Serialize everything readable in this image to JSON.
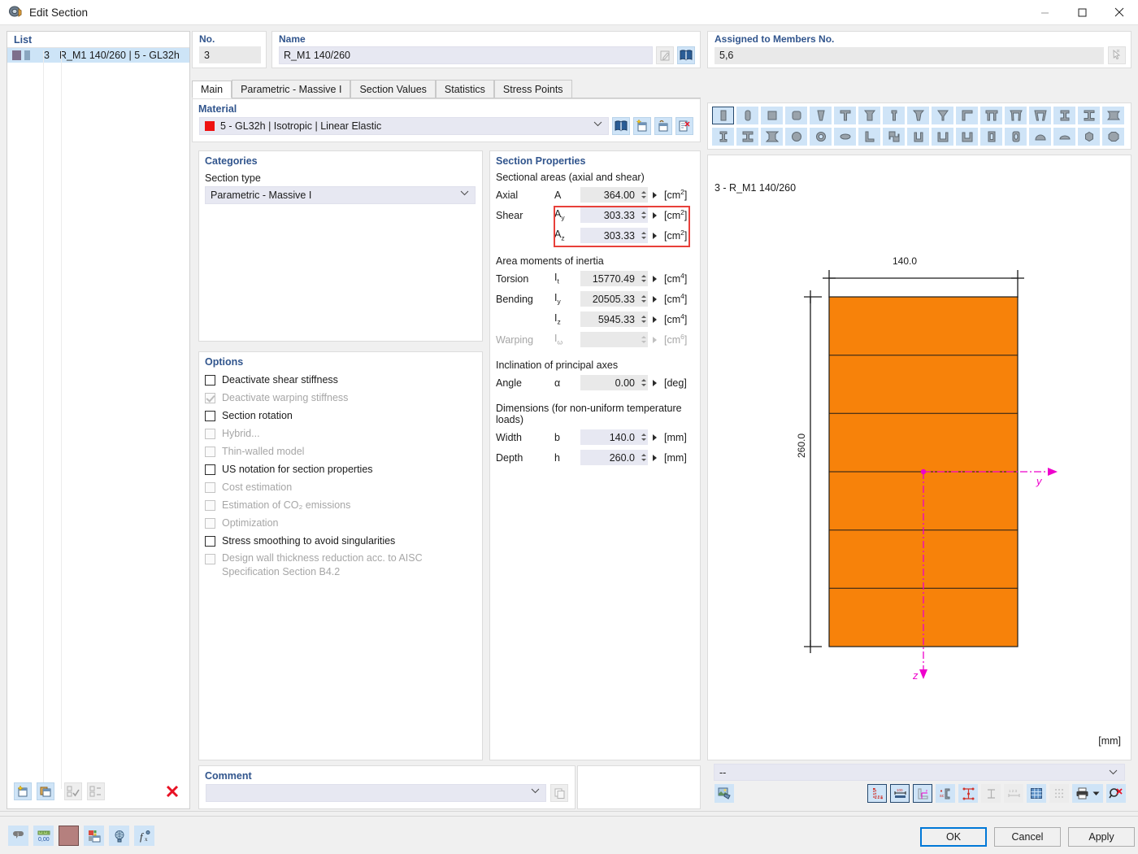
{
  "window": {
    "title": "Edit Section",
    "icon": "section-icon",
    "minimize": "minimize-icon",
    "maximize": "maximize-icon",
    "close": "close-icon"
  },
  "list": {
    "header": "List",
    "rows": [
      {
        "no": "3",
        "name": "R_M1 140/260 | 5 - GL32h"
      }
    ],
    "toolbar": [
      "new-section-icon",
      "copy-section-icon",
      "check-all-icon",
      "renumber-icon",
      "delete-icon"
    ]
  },
  "header": {
    "no_label": "No.",
    "no_value": "3",
    "name_label": "Name",
    "name_value": "R_M1 140/260",
    "name_edit_icon": "edit-icon",
    "name_library_icon": "library-icon",
    "members_label": "Assigned to Members No.",
    "members_value": "5,6",
    "members_pick_icon": "pick-cursor-icon"
  },
  "tabs": [
    {
      "label": "Main",
      "active": true
    },
    {
      "label": "Parametric - Massive I",
      "active": false
    },
    {
      "label": "Section Values",
      "active": false
    },
    {
      "label": "Statistics",
      "active": false
    },
    {
      "label": "Stress Points",
      "active": false
    }
  ],
  "material": {
    "legend": "Material",
    "value": "5 - GL32h | Isotropic | Linear Elastic",
    "swatch_color": "#ee1111",
    "buttons": [
      "material-library-icon",
      "new-material-icon",
      "edit-material-icon",
      "material-info-icon"
    ]
  },
  "categories": {
    "legend": "Categories",
    "section_type_label": "Section type",
    "section_type_value": "Parametric - Massive I"
  },
  "options": {
    "legend": "Options",
    "items": [
      {
        "label": "Deactivate shear stiffness",
        "checked": false,
        "enabled": true
      },
      {
        "label": "Deactivate warping stiffness",
        "checked": true,
        "enabled": false
      },
      {
        "label": "Section rotation",
        "checked": false,
        "enabled": true
      },
      {
        "label": "Hybrid...",
        "checked": false,
        "enabled": false
      },
      {
        "label": "Thin-walled model",
        "checked": false,
        "enabled": false
      },
      {
        "label": "US notation for section properties",
        "checked": false,
        "enabled": true
      },
      {
        "label": "Cost estimation",
        "checked": false,
        "enabled": false
      },
      {
        "label": "Estimation of CO₂ emissions",
        "checked": false,
        "enabled": false
      },
      {
        "label": "Optimization",
        "checked": false,
        "enabled": false
      },
      {
        "label": "Stress smoothing to avoid singularities",
        "checked": false,
        "enabled": true
      },
      {
        "label": "Design wall thickness reduction acc. to AISC Specification Section B4.2",
        "checked": false,
        "enabled": false
      }
    ]
  },
  "section_properties": {
    "legend": "Section Properties",
    "group_areas": "Sectional areas (axial and shear)",
    "group_inertia": "Area moments of inertia",
    "group_axes": "Inclination of principal axes",
    "group_dimensions": "Dimensions (for non-uniform temperature loads)",
    "rows": {
      "axial": {
        "name": "Axial",
        "sym": "A",
        "sub": "",
        "value": "364.00",
        "unit": "cm",
        "exp": "2",
        "enabled": true
      },
      "shear_y": {
        "name": "Shear",
        "sym": "A",
        "sub": "y",
        "value": "303.33",
        "unit": "cm",
        "exp": "2",
        "enabled": true
      },
      "shear_z": {
        "name": "",
        "sym": "A",
        "sub": "z",
        "value": "303.33",
        "unit": "cm",
        "exp": "2",
        "enabled": true
      },
      "torsion": {
        "name": "Torsion",
        "sym": "I",
        "sub": "t",
        "value": "15770.49",
        "unit": "cm",
        "exp": "4",
        "enabled": true
      },
      "bend_y": {
        "name": "Bending",
        "sym": "I",
        "sub": "y",
        "value": "20505.33",
        "unit": "cm",
        "exp": "4",
        "enabled": true
      },
      "bend_z": {
        "name": "",
        "sym": "I",
        "sub": "z",
        "value": "5945.33",
        "unit": "cm",
        "exp": "4",
        "enabled": true
      },
      "warping": {
        "name": "Warping",
        "sym": "I",
        "sub": "ω",
        "value": "",
        "unit": "cm",
        "exp": "6",
        "enabled": false
      },
      "angle": {
        "name": "Angle",
        "sym": "α",
        "sub": "",
        "value": "0.00",
        "unit": "deg",
        "exp": "",
        "enabled": true
      },
      "width": {
        "name": "Width",
        "sym": "b",
        "sub": "",
        "value": "140.0",
        "unit": "mm",
        "exp": "",
        "enabled": true
      },
      "depth": {
        "name": "Depth",
        "sym": "h",
        "sub": "",
        "value": "260.0",
        "unit": "mm",
        "exp": "",
        "enabled": true
      }
    },
    "highlight_color": "#e8403a"
  },
  "comment": {
    "legend": "Comment",
    "value": "",
    "copy_icon": "copy-icon"
  },
  "shapes": {
    "selected_index": 0,
    "row1": [
      "rect-vertical",
      "rect-round-vertical",
      "square",
      "square-round",
      "taper-v",
      "tee",
      "tee-stem",
      "tee-narrow",
      "tee-inverted",
      "tee-slope",
      "tee-left",
      "double-web",
      "double-web-slope",
      "double-web-v",
      "i-beam",
      "i-beam-narrow",
      "i-beam-wide"
    ],
    "row2": [
      "i-beam-tall",
      "i-beam-flanged",
      "i-beam-taper",
      "circle",
      "pipe",
      "ellipse",
      "angle-l",
      "zed",
      "channel-u",
      "channel-u-wide",
      "channel-u-square",
      "rect-hollow",
      "oval-hollow",
      "dome",
      "arch",
      "hexagon",
      "octagon"
    ]
  },
  "preview": {
    "title": "3 - R_M1 140/260",
    "unit_label": "[mm]",
    "dim_width": "140.0",
    "dim_depth": "260.0",
    "axis_y": "y",
    "axis_z": "z",
    "fill_color": "#f7820a",
    "axis_color": "#ee00cc",
    "layers": 6,
    "combo_value": "--",
    "toolbar": [
      "render-icon",
      "outline-icon",
      "dimensions-icon",
      "axes-icon",
      "shear-center-icon",
      "stress-points-icon",
      "parts-icon",
      "numbering-icon",
      "grid-icon",
      "snap-icon",
      "print-icon",
      "print-dropdown-icon",
      "zoom-reset-icon"
    ]
  },
  "footer": {
    "tools": [
      "info-icon",
      "units-icon",
      "color-swatch-icon",
      "display-properties-icon",
      "visibility-icon",
      "formula-icon"
    ],
    "swatch_color": "#b5807e",
    "ok": "OK",
    "cancel": "Cancel",
    "apply": "Apply"
  }
}
